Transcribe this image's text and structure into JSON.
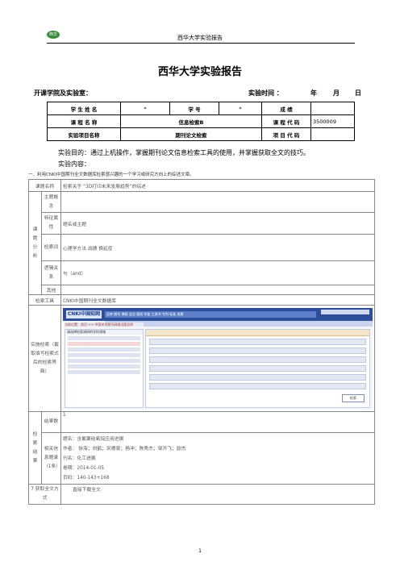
{
  "header": {
    "logo_text": "西华",
    "title": "西华大学实验报告"
  },
  "report": {
    "title": "西华大学实验报告",
    "college_label": "开课学院及实验室：",
    "time_label": "实验时间 ：",
    "year": "年",
    "month": "月",
    "day": "日"
  },
  "info": {
    "name_label": "学 生 姓 名",
    "name_value": "*",
    "id_label": "学 号",
    "id_value": "*",
    "grade_label": "成 绩",
    "course_label": "课 程 名 称",
    "course_value": "信息检索B",
    "code_label": "课 程 代 码",
    "code_value": "3500009",
    "project_label": "实验项目名称",
    "project_value": "期刊论文检索",
    "project_code_label": "项 目 代 码"
  },
  "purpose": {
    "line1": "实验目的：通过上机操作，掌握期刊论文信息检索工具的使用，并掌握获取全文的技巧。",
    "line2": "实验内容：",
    "note": "一、利用CNKI中国期刊全文数据库检索感兴趣的一个学习或研究方向上的综述文章。"
  },
  "table": {
    "topic_label": "课题名称",
    "topic_value": "检索关于 “3D打印未来发展趋势”的综述",
    "analysis_label": "课题分析",
    "concept_label": "主题概念",
    "feature_label": "特征属性",
    "feature_value": "题名或主题",
    "terms_label": "检索词",
    "terms_value": "心理学方法 战德 换延症",
    "logic_label": "逻辑关系",
    "logic_value": "与（and）",
    "other_label": "其他",
    "tool_label": "检索工具",
    "tool_value": "CNKI中国期刊全文数据库",
    "interface_label": "实施检索（截取填写检索式后的检索界面）",
    "result_label": "检索结果",
    "count_label": "结果数",
    "count_value": "1",
    "info_label": "相关信息题录（1条）",
    "r_title": "题名：含氟聚硅氧烷应用进展",
    "r_authors": "作者： 徐海；刘鹤；宋德豪；杨冲；陈秀杰；邹开飞；欧杰",
    "r_journal": "刊名：化工进展",
    "r_issue": "卷期：2014-01-05",
    "r_pages": "页码：140-143+168",
    "fulltext_label": "7 获取全文方式",
    "fulltext_value": "直接下载全文"
  },
  "screenshot": {
    "brand": "CNKI中国知网",
    "nav": "总库 期刊 博硕 会议 报纸 年鉴 工具书 专利 标准 成果",
    "crumb": "当前位置：首页 >> 中国学术期刊网络出版总库",
    "side_title": "请选择检索调研的学科领域",
    "search_button": "检索"
  },
  "page_number": "1"
}
